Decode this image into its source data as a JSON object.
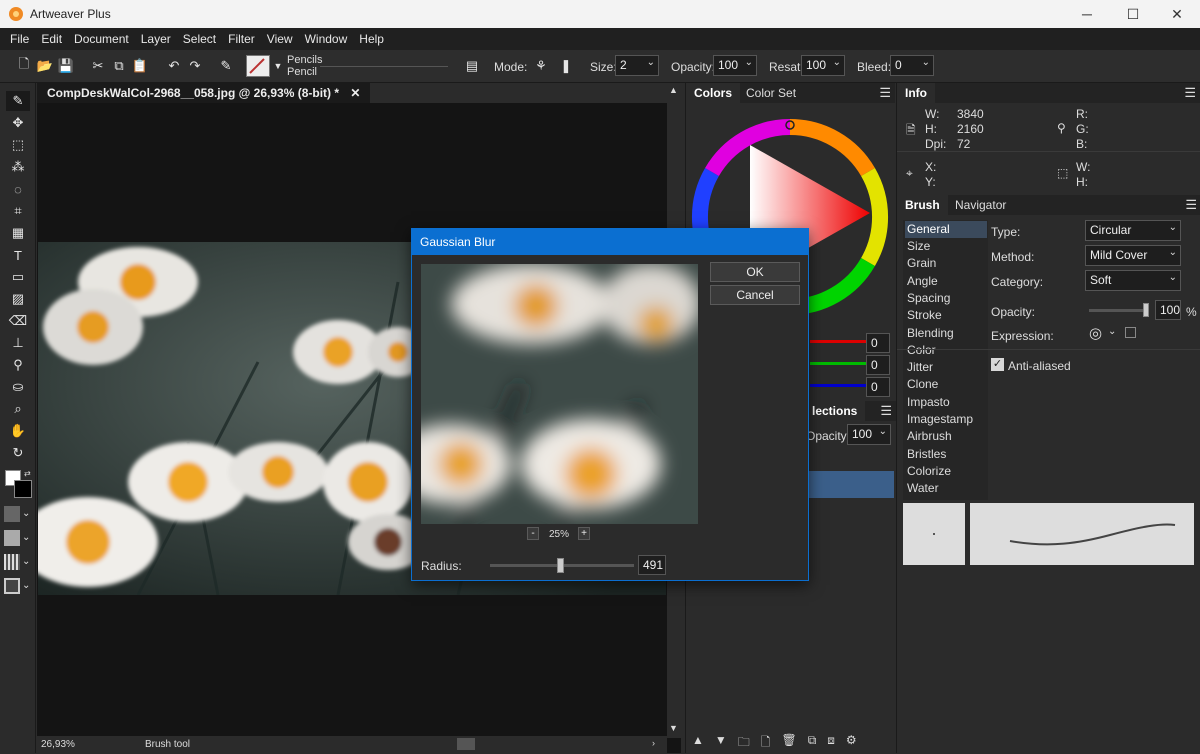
{
  "app": {
    "title": "Artweaver Plus"
  },
  "window_controls": {
    "minimize": "─",
    "maximize": "☐",
    "close": "✕"
  },
  "menu": [
    "File",
    "Edit",
    "Document",
    "Layer",
    "Select",
    "Filter",
    "View",
    "Window",
    "Help"
  ],
  "toolbar": {
    "brush_category": "Pencils",
    "brush_variant": "Pencil",
    "mode_label": "Mode:",
    "size_label": "Size:",
    "size_value": "2",
    "opacity_label": "Opacity:",
    "opacity_value": "100",
    "resat_label": "Resat:",
    "resat_value": "100",
    "bleed_label": "Bleed:",
    "bleed_value": "0"
  },
  "document": {
    "tab_title": "CompDeskWalCol-2968__058.jpg @ 26,93% (8-bit) *",
    "tab_close": "✕",
    "zoom": "26,93%",
    "status_tool": "Brush tool"
  },
  "colors_panel": {
    "tabs": [
      "Colors",
      "Color Set"
    ],
    "r_value": "0",
    "g_value": "0",
    "b_value": "0"
  },
  "layers_panel": {
    "tab_partial": "lections",
    "opacity_label": "Opacity:",
    "opacity_value": "100"
  },
  "info_panel": {
    "tab": "Info",
    "w_label": "W:",
    "w_value": "3840",
    "h_label": "H:",
    "h_value": "2160",
    "dpi_label": "Dpi:",
    "dpi_value": "72",
    "r_label": "R:",
    "g_label": "G:",
    "b_label": "B:",
    "x_label": "X:",
    "y_label": "Y:",
    "w2_label": "W:",
    "h2_label": "H:"
  },
  "brush_panel": {
    "tabs": [
      "Brush",
      "Navigator"
    ],
    "categories": [
      "General",
      "Size",
      "Grain",
      "Angle",
      "Spacing",
      "Stroke",
      "Blending",
      "Color",
      "Jitter",
      "Clone",
      "Impasto",
      "Imagestamp",
      "Airbrush",
      "Bristles",
      "Colorize",
      "Water"
    ],
    "active_category": "General",
    "type_label": "Type:",
    "type_value": "Circular",
    "method_label": "Method:",
    "method_value": "Mild Cover",
    "category_label": "Category:",
    "category_value": "Soft",
    "opacity_label": "Opacity:",
    "opacity_value": "100",
    "opacity_unit": "%",
    "expression_label": "Expression:",
    "antialiased_label": "Anti-aliased",
    "antialiased_checked": true
  },
  "dialog": {
    "title": "Gaussian Blur",
    "ok_label": "OK",
    "cancel_label": "Cancel",
    "zoom_minus": "-",
    "zoom_value": "25%",
    "zoom_plus": "+",
    "radius_label": "Radius:",
    "radius_value": "491",
    "radius_level": 0.37
  },
  "colors": {
    "accent": "#0b6fd1",
    "fg": "#ffffff",
    "bg": "#000000"
  }
}
